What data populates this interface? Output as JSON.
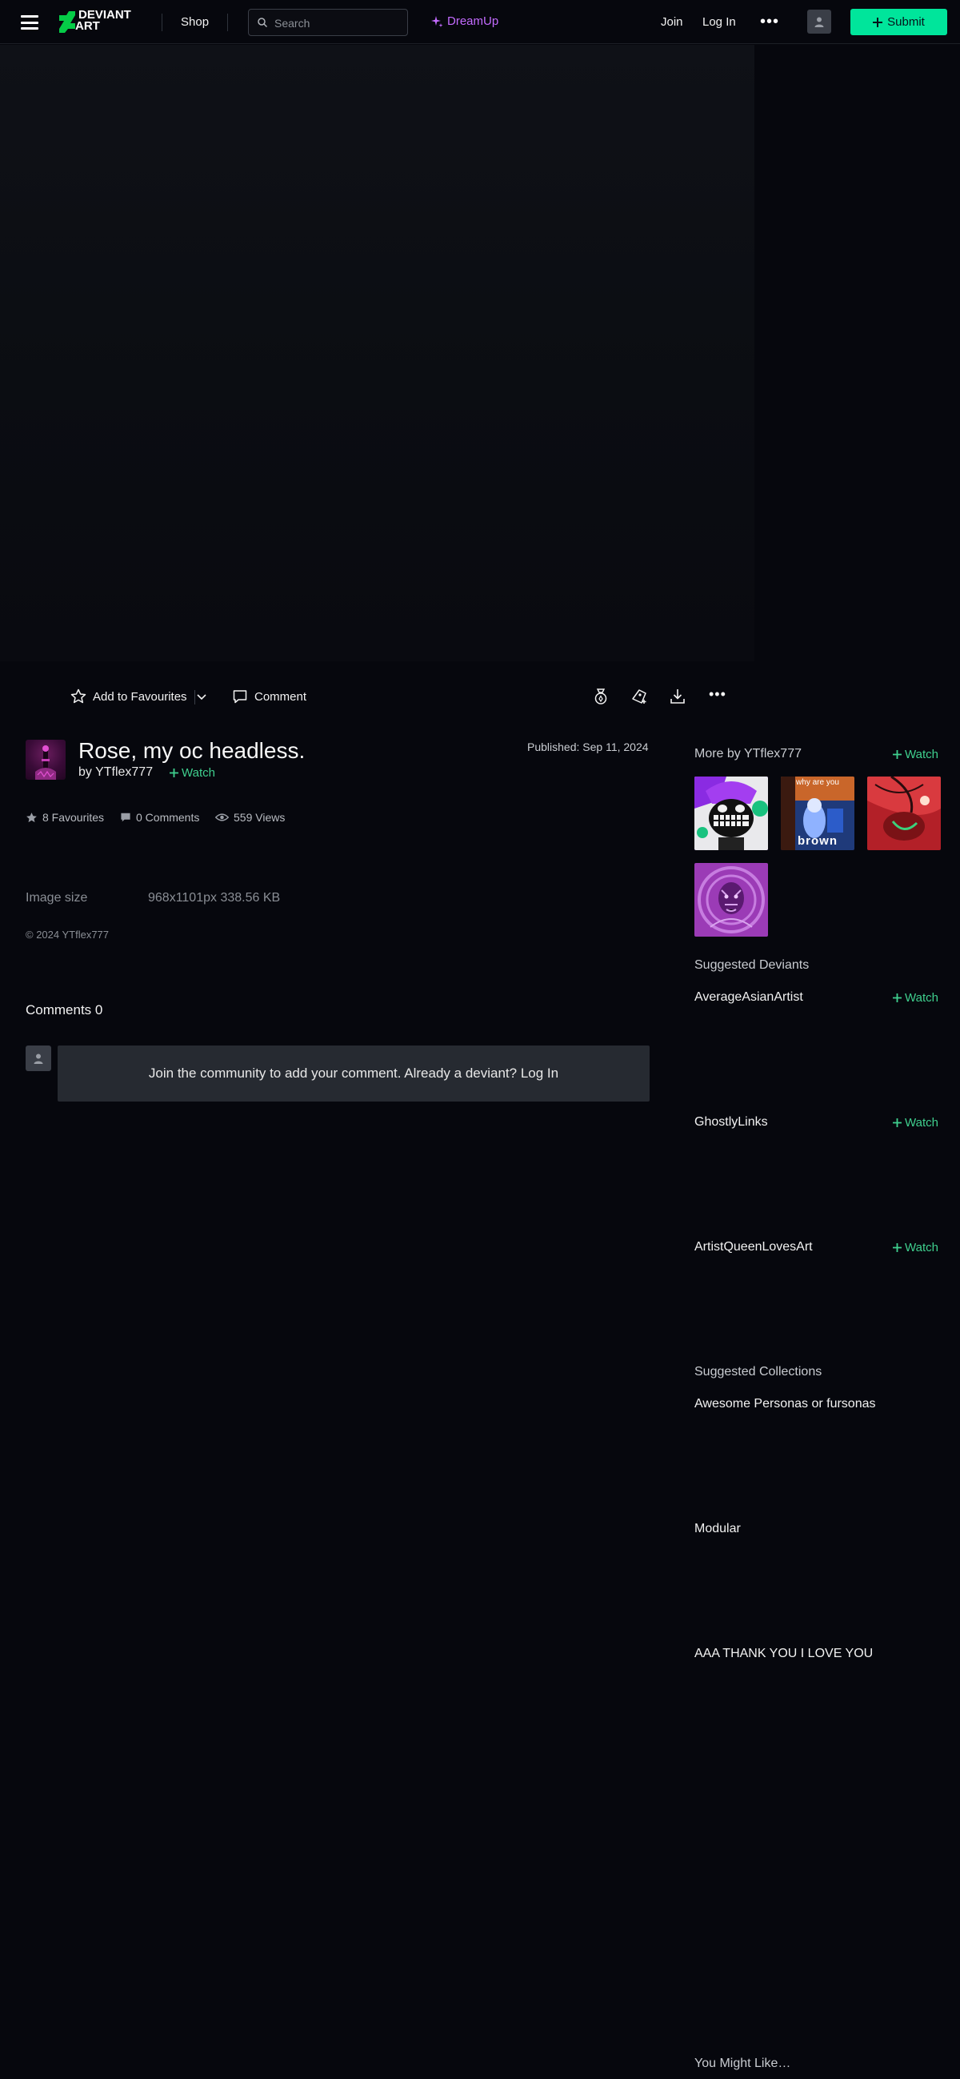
{
  "header": {
    "logo_line1": "DEVIANT",
    "logo_line2": "ART",
    "shop": "Shop",
    "search_placeholder": "Search",
    "dreamup": "DreamUp",
    "join": "Join",
    "login": "Log In",
    "submit": "Submit"
  },
  "actions": {
    "add_fav": "Add to Favourites",
    "comment": "Comment"
  },
  "deviation": {
    "title": "Rose, my oc headless.",
    "by_prefix": "by",
    "author": "YTflex777",
    "watch": "Watch",
    "published": "Published: Sep 11, 2024",
    "favourites": "8 Favourites",
    "comments": "0 Comments",
    "views": "559 Views",
    "image_size_label": "Image size",
    "image_size_value": "968x1101px 338.56 KB",
    "copyright": "© 2024 YTflex777"
  },
  "comments": {
    "title": "Comments 0",
    "prompt": "Join the community to add your comment. Already a deviant? Log In"
  },
  "sidebar": {
    "more_by": "More by YTflex777",
    "watch": "Watch",
    "suggested_deviants_title": "Suggested Deviants",
    "deviants": [
      {
        "name": "AverageAsianArtist"
      },
      {
        "name": "GhostlyLinks"
      },
      {
        "name": "ArtistQueenLovesArt"
      }
    ],
    "suggested_collections_title": "Suggested Collections",
    "collections": [
      {
        "name": "Awesome Personas or fursonas"
      },
      {
        "name": "Modular"
      },
      {
        "name": "AAA THANK YOU I LOVE YOU"
      }
    ],
    "you_might_like": "You Might Like…",
    "thumb2_text_top": "why are you",
    "thumb2_text_bottom": "brown"
  },
  "colors": {
    "background": "#06070d",
    "accent_green": "#00e59b",
    "watch_green": "#3fcf8e",
    "dreamup_purple": "#c36bff"
  }
}
